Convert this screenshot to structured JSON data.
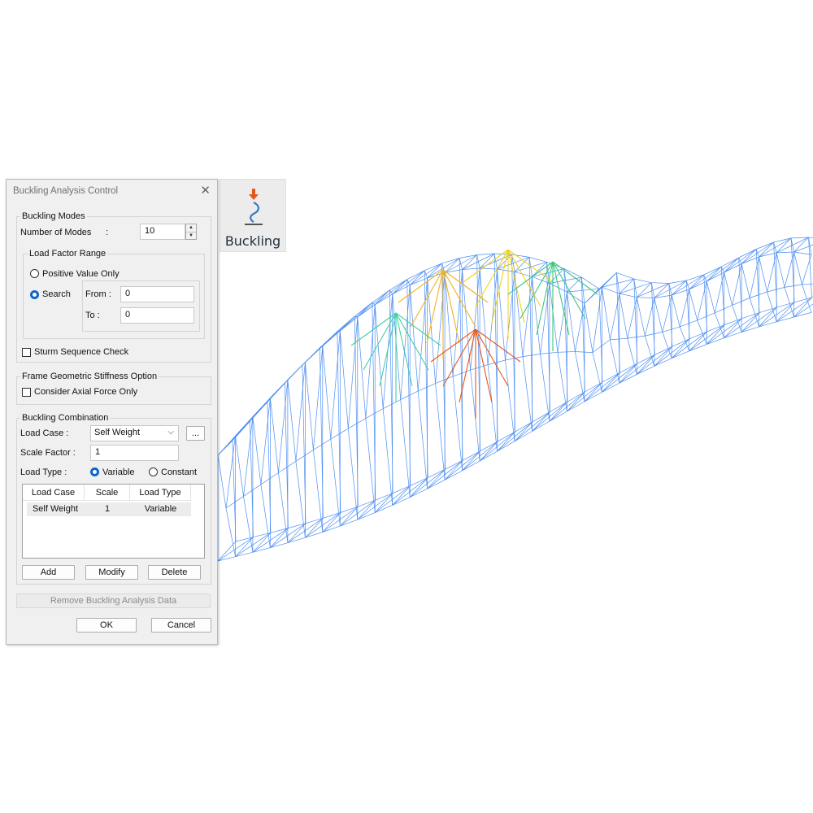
{
  "ribbon": {
    "label": "Buckling",
    "icon": "buckling-icon"
  },
  "dialog": {
    "title": "Buckling Analysis Control",
    "buckling_modes": {
      "group_title": "Buckling Modes",
      "number_of_modes_label": "Number of Modes",
      "colon": ":",
      "number_of_modes_value": "10"
    },
    "load_factor_range": {
      "group_title": "Load Factor Range",
      "positive_value_only": "Positive Value Only",
      "search": "Search",
      "selected": "search",
      "from_label": "From :",
      "from_value": "0",
      "to_label": "To :",
      "to_value": "0"
    },
    "sturm_sequence_check": {
      "label": "Sturm Sequence Check",
      "checked": false
    },
    "frame_geometric_stiffness": {
      "group_title": "Frame Geometric Stiffness Option",
      "consider_axial_force_only": "Consider Axial Force Only",
      "checked": false
    },
    "buckling_combination": {
      "group_title": "Buckling Combination",
      "load_case_label": "Load Case :",
      "load_case_value": "Self Weight",
      "browse_label": "...",
      "scale_factor_label": "Scale Factor :",
      "scale_factor_value": "1",
      "load_type_label": "Load Type :",
      "variable": "Variable",
      "constant": "Constant",
      "selected": "variable",
      "table": {
        "columns": [
          "Load Case",
          "Scale",
          "Load Type"
        ],
        "rows": [
          {
            "load_case": "Self Weight",
            "scale": "1",
            "load_type": "Variable"
          }
        ]
      },
      "add": "Add",
      "modify": "Modify",
      "delete": "Delete"
    },
    "remove_button": "Remove Buckling Analysis Data",
    "ok": "OK",
    "cancel": "Cancel"
  },
  "colors": {
    "mesh_blue": "#2e7bf0",
    "radio_selected": "#1066c7",
    "arrow_orange": "#e8561c",
    "icon_blue": "#3a78c9"
  }
}
